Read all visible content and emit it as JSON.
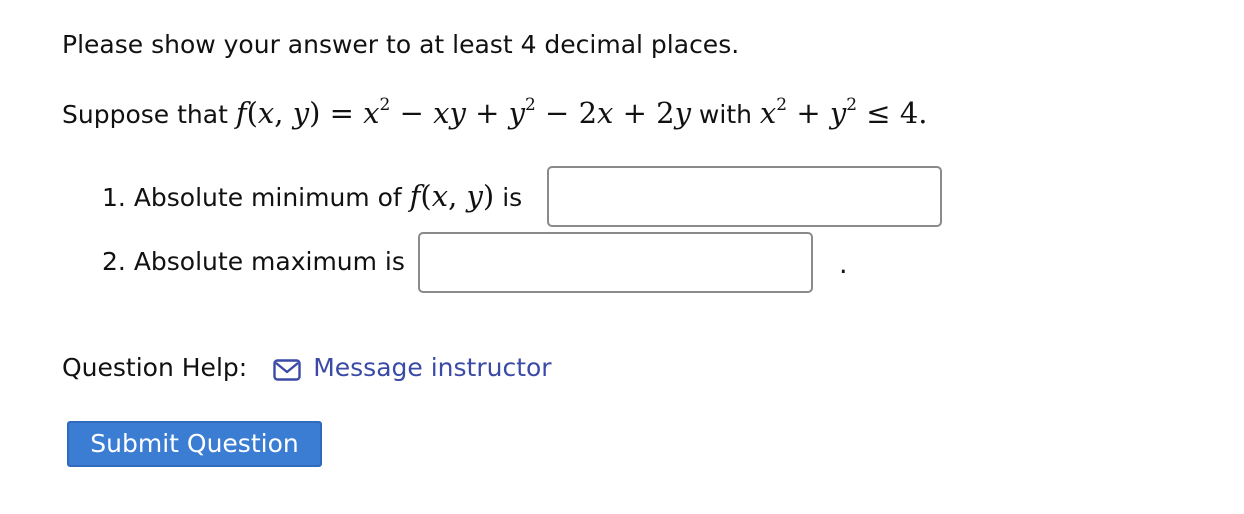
{
  "instruction": "Please show your answer to at least 4 decimal places.",
  "problem": {
    "prefix": "Suppose that",
    "function_lhs": "f(x, y)",
    "equals": "=",
    "expression": "x² − xy + y² − 2x + 2y",
    "with_word": "with",
    "constraint": "x² + y² ≤ 4."
  },
  "questions": [
    {
      "number": "1.",
      "label_pre": "Absolute minimum of",
      "label_math": "f(x, y)",
      "label_post": "is",
      "value": "",
      "placeholder": ""
    },
    {
      "number": "2.",
      "label": "Absolute maximum is",
      "value": "",
      "placeholder": "",
      "suffix": "."
    }
  ],
  "help": {
    "label": "Question Help:",
    "icon": "envelope-icon",
    "link": "Message instructor"
  },
  "submit_label": "Submit Question",
  "colors": {
    "link": "#3a4aa6",
    "button_bg": "#3a7dd3",
    "input_border": "#8a8a8a"
  }
}
